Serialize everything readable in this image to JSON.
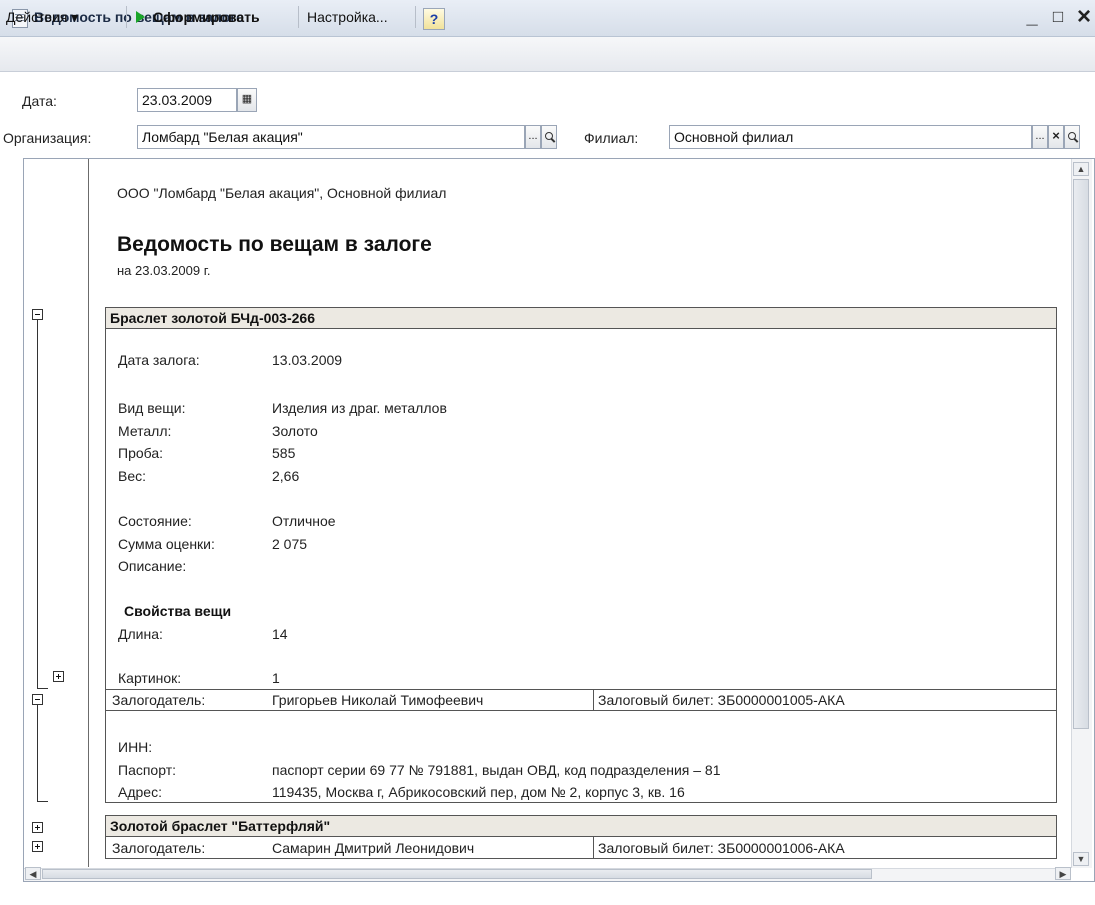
{
  "window": {
    "title": "Ведомость по вещам в залоге",
    "minimize": "_",
    "maximize": "□",
    "close": "×"
  },
  "toolbar": {
    "actions": "Действия ▾",
    "generate": "Сформировать",
    "settings": "Настройка...",
    "help": "?"
  },
  "form": {
    "date_label": "Дата:",
    "date_value": "23.03.2009",
    "org_label": "Организация:",
    "org_value": "Ломбард \"Белая акация\"",
    "branch_label": "Филиал:",
    "branch_value": "Основной филиал",
    "select_btn": "..."
  },
  "report": {
    "org_line": "ООО \"Ломбард \"Белая акация\", Основной филиал",
    "title": "Ведомость по вещам в залоге",
    "date_line": "на 23.03.2009 г.",
    "items": [
      {
        "name": "Браслет золотой БЧд-003-266",
        "details": [
          {
            "label": "Дата залога:",
            "value": "13.03.2009"
          },
          {
            "label": "Вид вещи:",
            "value": "Изделия из драг. металлов"
          },
          {
            "label": "Металл:",
            "value": "Золото"
          },
          {
            "label": "Проба:",
            "value": "585"
          },
          {
            "label": "Вес:",
            "value": "2,66"
          },
          {
            "label": "Состояние:",
            "value": "Отличное"
          },
          {
            "label": "Сумма оценки:",
            "value": "2 075"
          },
          {
            "label": "Описание:",
            "value": ""
          }
        ],
        "properties_title": "Свойства вещи",
        "properties": [
          {
            "label": "Длина:",
            "value": "14"
          }
        ],
        "pictures": {
          "label": "Картинок:",
          "value": "1"
        },
        "pledger_label": "Залогодатель:",
        "pledger": "Григорьев Николай Тимофеевич",
        "ticket": "Залоговый билет:  ЗБ0000001005-АКА",
        "pledger_details": [
          {
            "label": "ИНН:",
            "value": ""
          },
          {
            "label": "Паспорт:",
            "value": "паспорт серии 69 77 № 791881, выдан ОВД, код подразделения – 81"
          },
          {
            "label": "Адрес:",
            "value": "119435, Москва г, Абрикосовский пер, дом № 2, корпус 3, кв. 16"
          }
        ]
      },
      {
        "name": "Золотой браслет \"Баттерфляй\"",
        "pledger_label": "Залогодатель:",
        "pledger": "Самарин Дмитрий Леонидович",
        "ticket": "Залоговый билет:  ЗБ0000001006-АКА"
      }
    ]
  },
  "scroll": {
    "up": "▲",
    "down": "▼",
    "left": "◀",
    "right": "▶"
  }
}
